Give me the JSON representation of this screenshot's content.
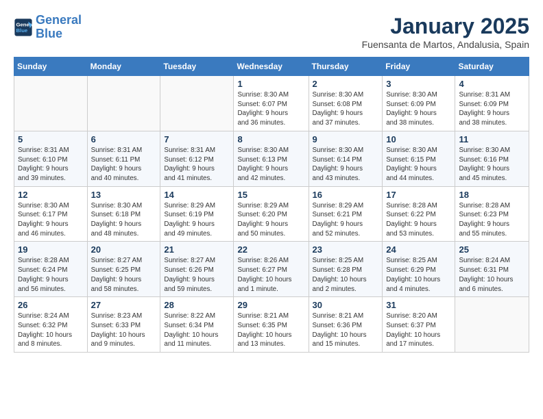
{
  "header": {
    "logo_line1": "General",
    "logo_line2": "Blue",
    "month": "January 2025",
    "location": "Fuensanta de Martos, Andalusia, Spain"
  },
  "columns": [
    "Sunday",
    "Monday",
    "Tuesday",
    "Wednesday",
    "Thursday",
    "Friday",
    "Saturday"
  ],
  "weeks": [
    [
      {
        "day": "",
        "info": ""
      },
      {
        "day": "",
        "info": ""
      },
      {
        "day": "",
        "info": ""
      },
      {
        "day": "1",
        "info": "Sunrise: 8:30 AM\nSunset: 6:07 PM\nDaylight: 9 hours\nand 36 minutes."
      },
      {
        "day": "2",
        "info": "Sunrise: 8:30 AM\nSunset: 6:08 PM\nDaylight: 9 hours\nand 37 minutes."
      },
      {
        "day": "3",
        "info": "Sunrise: 8:30 AM\nSunset: 6:09 PM\nDaylight: 9 hours\nand 38 minutes."
      },
      {
        "day": "4",
        "info": "Sunrise: 8:31 AM\nSunset: 6:09 PM\nDaylight: 9 hours\nand 38 minutes."
      }
    ],
    [
      {
        "day": "5",
        "info": "Sunrise: 8:31 AM\nSunset: 6:10 PM\nDaylight: 9 hours\nand 39 minutes."
      },
      {
        "day": "6",
        "info": "Sunrise: 8:31 AM\nSunset: 6:11 PM\nDaylight: 9 hours\nand 40 minutes."
      },
      {
        "day": "7",
        "info": "Sunrise: 8:31 AM\nSunset: 6:12 PM\nDaylight: 9 hours\nand 41 minutes."
      },
      {
        "day": "8",
        "info": "Sunrise: 8:30 AM\nSunset: 6:13 PM\nDaylight: 9 hours\nand 42 minutes."
      },
      {
        "day": "9",
        "info": "Sunrise: 8:30 AM\nSunset: 6:14 PM\nDaylight: 9 hours\nand 43 minutes."
      },
      {
        "day": "10",
        "info": "Sunrise: 8:30 AM\nSunset: 6:15 PM\nDaylight: 9 hours\nand 44 minutes."
      },
      {
        "day": "11",
        "info": "Sunrise: 8:30 AM\nSunset: 6:16 PM\nDaylight: 9 hours\nand 45 minutes."
      }
    ],
    [
      {
        "day": "12",
        "info": "Sunrise: 8:30 AM\nSunset: 6:17 PM\nDaylight: 9 hours\nand 46 minutes."
      },
      {
        "day": "13",
        "info": "Sunrise: 8:30 AM\nSunset: 6:18 PM\nDaylight: 9 hours\nand 48 minutes."
      },
      {
        "day": "14",
        "info": "Sunrise: 8:29 AM\nSunset: 6:19 PM\nDaylight: 9 hours\nand 49 minutes."
      },
      {
        "day": "15",
        "info": "Sunrise: 8:29 AM\nSunset: 6:20 PM\nDaylight: 9 hours\nand 50 minutes."
      },
      {
        "day": "16",
        "info": "Sunrise: 8:29 AM\nSunset: 6:21 PM\nDaylight: 9 hours\nand 52 minutes."
      },
      {
        "day": "17",
        "info": "Sunrise: 8:28 AM\nSunset: 6:22 PM\nDaylight: 9 hours\nand 53 minutes."
      },
      {
        "day": "18",
        "info": "Sunrise: 8:28 AM\nSunset: 6:23 PM\nDaylight: 9 hours\nand 55 minutes."
      }
    ],
    [
      {
        "day": "19",
        "info": "Sunrise: 8:28 AM\nSunset: 6:24 PM\nDaylight: 9 hours\nand 56 minutes."
      },
      {
        "day": "20",
        "info": "Sunrise: 8:27 AM\nSunset: 6:25 PM\nDaylight: 9 hours\nand 58 minutes."
      },
      {
        "day": "21",
        "info": "Sunrise: 8:27 AM\nSunset: 6:26 PM\nDaylight: 9 hours\nand 59 minutes."
      },
      {
        "day": "22",
        "info": "Sunrise: 8:26 AM\nSunset: 6:27 PM\nDaylight: 10 hours\nand 1 minute."
      },
      {
        "day": "23",
        "info": "Sunrise: 8:25 AM\nSunset: 6:28 PM\nDaylight: 10 hours\nand 2 minutes."
      },
      {
        "day": "24",
        "info": "Sunrise: 8:25 AM\nSunset: 6:29 PM\nDaylight: 10 hours\nand 4 minutes."
      },
      {
        "day": "25",
        "info": "Sunrise: 8:24 AM\nSunset: 6:31 PM\nDaylight: 10 hours\nand 6 minutes."
      }
    ],
    [
      {
        "day": "26",
        "info": "Sunrise: 8:24 AM\nSunset: 6:32 PM\nDaylight: 10 hours\nand 8 minutes."
      },
      {
        "day": "27",
        "info": "Sunrise: 8:23 AM\nSunset: 6:33 PM\nDaylight: 10 hours\nand 9 minutes."
      },
      {
        "day": "28",
        "info": "Sunrise: 8:22 AM\nSunset: 6:34 PM\nDaylight: 10 hours\nand 11 minutes."
      },
      {
        "day": "29",
        "info": "Sunrise: 8:21 AM\nSunset: 6:35 PM\nDaylight: 10 hours\nand 13 minutes."
      },
      {
        "day": "30",
        "info": "Sunrise: 8:21 AM\nSunset: 6:36 PM\nDaylight: 10 hours\nand 15 minutes."
      },
      {
        "day": "31",
        "info": "Sunrise: 8:20 AM\nSunset: 6:37 PM\nDaylight: 10 hours\nand 17 minutes."
      },
      {
        "day": "",
        "info": ""
      }
    ]
  ]
}
